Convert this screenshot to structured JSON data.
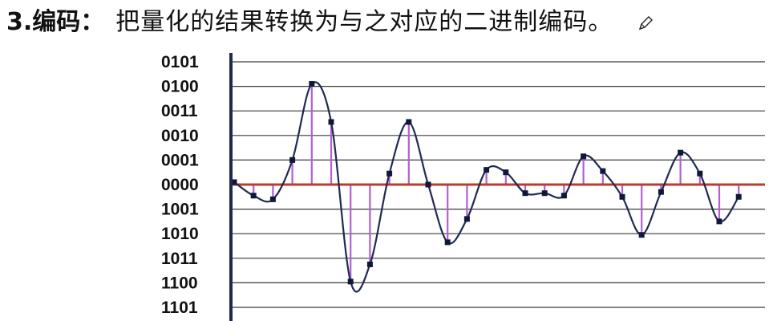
{
  "header": {
    "number_title": "3.编码：",
    "description": "把量化的结果转换为与之对应的二进制编码。",
    "edit_icon": "pencil-icon"
  },
  "chart_data": {
    "type": "line",
    "y_tick_labels": [
      "0101",
      "0100",
      "0011",
      "0010",
      "0001",
      "0000",
      "1001",
      "1010",
      "1011",
      "1100",
      "1101"
    ],
    "y_levels": [
      5,
      4,
      3,
      2,
      1,
      0,
      -1,
      -2,
      -3,
      -4,
      -5
    ],
    "ylim": [
      -5,
      5
    ],
    "samples": [
      0.1,
      -0.45,
      -0.6,
      1.0,
      4.1,
      2.55,
      -3.95,
      -3.25,
      0.45,
      2.55,
      0.0,
      -2.35,
      -1.4,
      0.6,
      0.5,
      -0.35,
      -0.35,
      -0.45,
      1.15,
      0.55,
      -0.5,
      -2.05,
      -0.3,
      1.3,
      0.45,
      -1.5,
      -0.5
    ],
    "grid": true,
    "zero_line_color": "#c0392b",
    "stem_color": "#b15fd6",
    "curve_color": "#1f2a52",
    "axis_color": "#1e2a52"
  }
}
